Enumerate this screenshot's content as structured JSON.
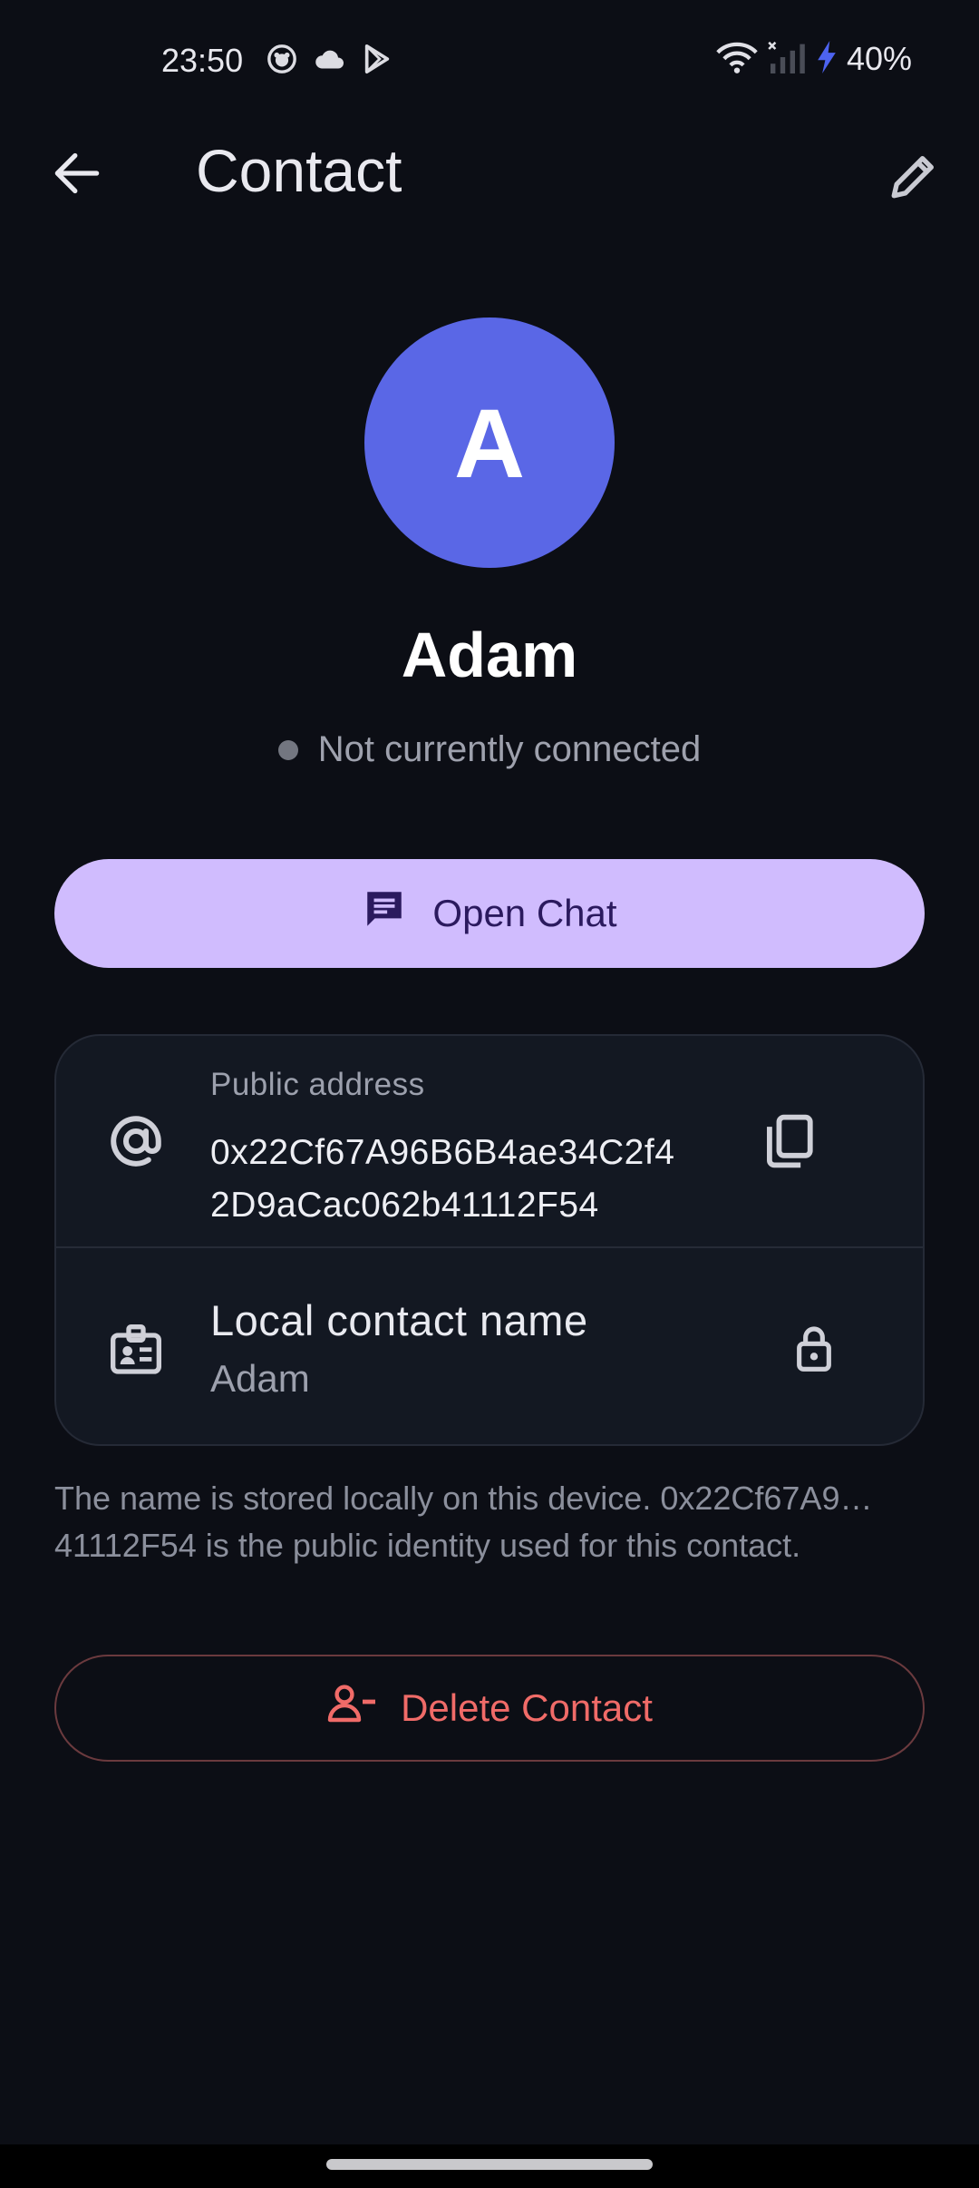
{
  "status_bar": {
    "time": "23:50",
    "left_icons": [
      "face-icon",
      "cloud-icon",
      "play-store-icon"
    ],
    "right_icons": [
      "wifi-icon",
      "signal-icon",
      "charging-icon"
    ],
    "battery": "40%"
  },
  "app_bar": {
    "title": "Contact",
    "back_icon": "arrow-back-icon",
    "edit_icon": "pencil-icon"
  },
  "contact": {
    "avatar_letter": "A",
    "avatar_color": "#5a67e6",
    "name": "Adam",
    "connection_status": "Not currently connected"
  },
  "actions": {
    "open_chat": "Open Chat",
    "delete_contact": "Delete Contact"
  },
  "details": {
    "public_address_label": "Public address",
    "public_address_value": "0x22Cf67A96B6B4ae34C2f42D9aCac062b41112F54",
    "local_name_label": "Local contact name",
    "local_name_value": "Adam"
  },
  "helper_text": "The name is stored locally on this device. 0x22Cf67A9… 41112F54 is the public identity used for this contact.",
  "colors": {
    "background": "#0c0e15",
    "accent": "#d0bcfe",
    "danger": "#f06b68"
  }
}
